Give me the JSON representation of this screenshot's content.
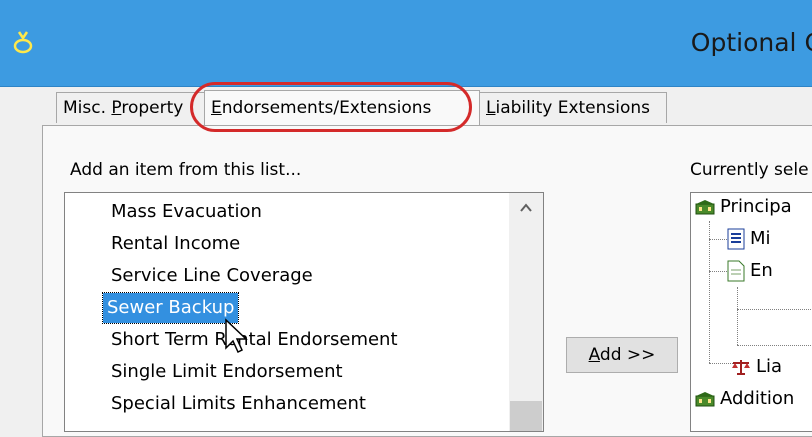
{
  "window": {
    "title": "Optional Cov",
    "icon": "ring-icon"
  },
  "tabs": [
    {
      "pre": "Misc. ",
      "accel": "P",
      "post": "roperty",
      "active": false
    },
    {
      "pre": "",
      "accel": "E",
      "post": "ndorsements/Extensions",
      "active": true
    },
    {
      "pre": "",
      "accel": "L",
      "post": "iability Extensions",
      "active": false
    }
  ],
  "left_panel": {
    "label": "Add an item from this list...",
    "items": [
      "Mass Evacuation",
      "Rental Income",
      "Service Line Coverage",
      "Sewer Backup",
      "Short Term Rental Endorsement",
      "Single Limit Endorsement",
      "Special Limits Enhancement"
    ],
    "selected_index": 3
  },
  "add_button": {
    "accel": "A",
    "post": "dd >>"
  },
  "right_panel": {
    "label": "Currently sele",
    "tree": [
      {
        "label": "Principa",
        "icon": "building-icon"
      },
      {
        "label": "Mi",
        "icon": "document-list-icon"
      },
      {
        "label": "En",
        "icon": "document-icon"
      },
      {
        "label": "Lia",
        "icon": "scales-icon"
      },
      {
        "label": "Addition",
        "icon": "building-icon"
      }
    ]
  },
  "colors": {
    "titlebar": "#3d9be1",
    "selection": "#3390e0",
    "highlight_ring": "#d42a2a"
  }
}
